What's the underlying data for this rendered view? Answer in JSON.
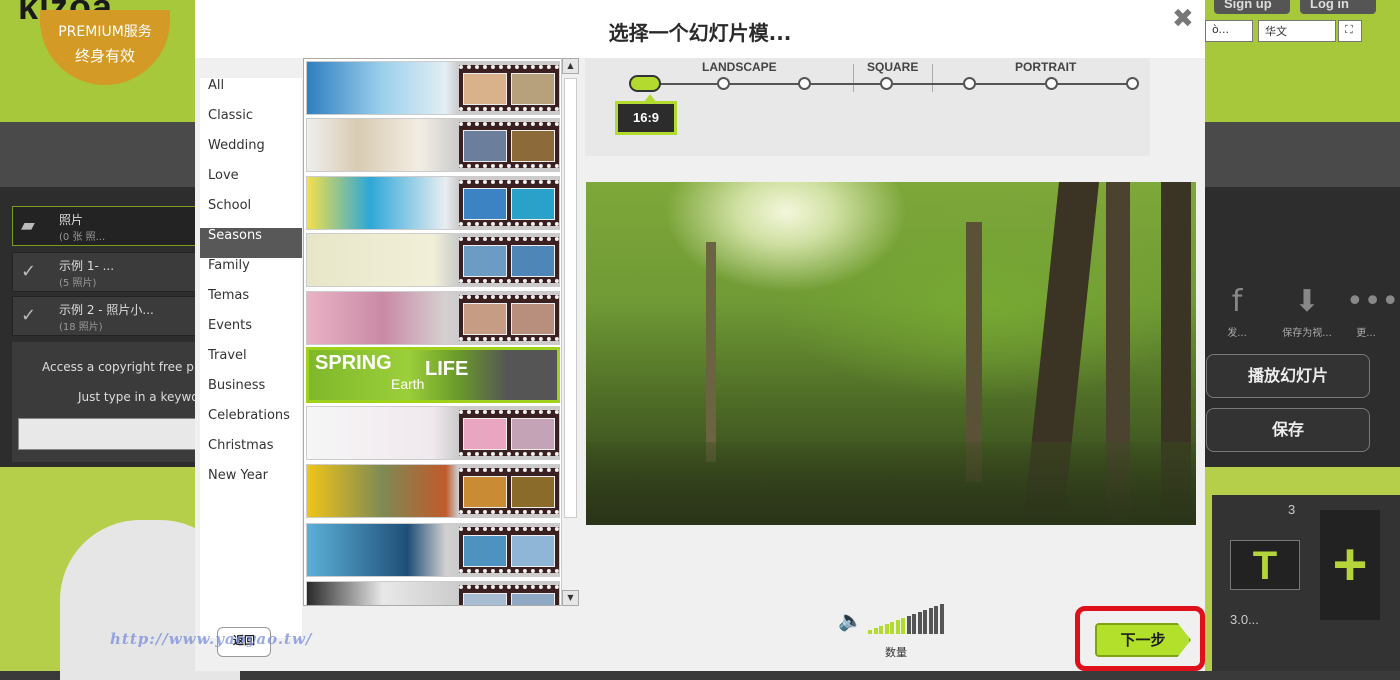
{
  "background_app": {
    "logo": "kizoa",
    "premium_line1": "PREMIUM服务",
    "premium_line2": "终身有效",
    "signup": "Sign up",
    "login": "Log in",
    "select_left": "ò...",
    "select_lang": "华文",
    "sidebar": [
      {
        "title": "照片",
        "sub": "(0 张 照..."
      },
      {
        "title": "示例 1- ...",
        "sub": "(5 照片)"
      },
      {
        "title": "示例 2 - 照片小...",
        "sub": "(18 照片)"
      }
    ],
    "access_line1": "Access a copyright free pho",
    "access_line2": "Just type in a keywor",
    "right_icons": [
      {
        "label": "发..."
      },
      {
        "label": "保存为视..."
      },
      {
        "label": "更..."
      }
    ],
    "play_button": "播放幻灯片",
    "save_button": "保存",
    "timeline_number": "3",
    "timeline_duration": "3.0..."
  },
  "modal": {
    "title": "选择一个幻灯片模...",
    "categories": [
      "All",
      "Classic",
      "Wedding",
      "Love",
      "School",
      "Seasons",
      "Family",
      "Temas",
      "Events",
      "Travel",
      "Business",
      "Celebrations",
      "Christmas",
      "New Year"
    ],
    "selected_category": "Seasons",
    "thumbnail_overlay_words": [
      "SPRING",
      "Earth",
      "LIFE"
    ],
    "ratio_groups": [
      "LANDSCAPE",
      "SQUARE",
      "PORTRAIT"
    ],
    "ratio_selected": "16:9",
    "volume_label": "数量",
    "back_button": "返回",
    "next_button": "下一步"
  },
  "watermark": "http://www.yaoyao.tw/",
  "colors": {
    "accent_green": "#b3da2f",
    "highlight_red": "#e0101a",
    "selected_cat": "#585858"
  }
}
